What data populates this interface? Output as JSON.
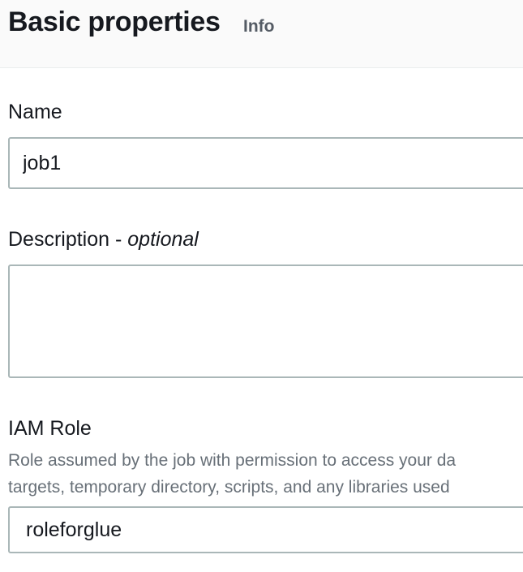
{
  "section": {
    "title": "Basic properties",
    "info_label": "Info"
  },
  "name_field": {
    "label": "Name",
    "value": "job1"
  },
  "description_field": {
    "label": "Description - ",
    "optional_label": "optional",
    "value": ""
  },
  "iam_role_field": {
    "label": "IAM Role",
    "help_line_1": "Role assumed by the job with permission to access your da",
    "help_line_2": "targets, temporary directory, scripts, and any libraries used",
    "selected_value": "roleforglue"
  }
}
